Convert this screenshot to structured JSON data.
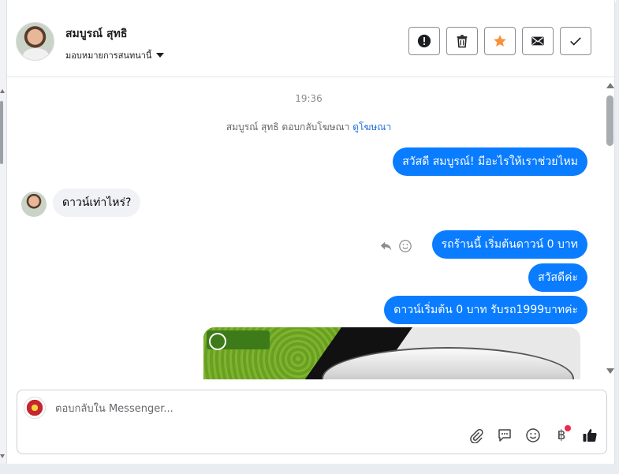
{
  "header": {
    "contact_name": "สมบูรณ์ สุทธิ",
    "assign_label": "มอบหมายการสนทนานี้"
  },
  "thread": {
    "time": "19:36",
    "ad_reply_prefix": "สมบูรณ์ สุทธิ ตอบกลับโฆษณา",
    "ad_reply_link": "ดูโฆษณา",
    "messages": [
      {
        "direction": "out",
        "text": "สวัสดี สมบูรณ์! มีอะไรให้เราช่วยไหม"
      },
      {
        "direction": "in",
        "text": "ดาวน์เท่าไหร่?"
      },
      {
        "direction": "out",
        "text": "รถร้านนี้ เริ่มต้นดาวน์ 0 บาท"
      },
      {
        "direction": "out",
        "text": "สวัสดีค่ะ"
      },
      {
        "direction": "out",
        "text": "ดาวน์เริ่มต้น 0 บาท รับรถ1999บาทค่ะ"
      }
    ]
  },
  "composer": {
    "placeholder": "ตอบกลับใน Messenger...",
    "baht_symbol": "฿"
  },
  "icons": {
    "actions": [
      "alert-icon",
      "trash-icon",
      "star-icon",
      "mail-icon",
      "check-icon"
    ],
    "composer": [
      "paperclip-icon",
      "chat-bubble-icon",
      "smiley-icon",
      "baht-icon",
      "thumbs-up-icon"
    ]
  },
  "colors": {
    "outgoing_bubble": "#0a7cff",
    "incoming_bubble": "#f0f2f5",
    "star": "#f7923b",
    "link": "#216fdb",
    "notification_dot": "#f02849"
  }
}
